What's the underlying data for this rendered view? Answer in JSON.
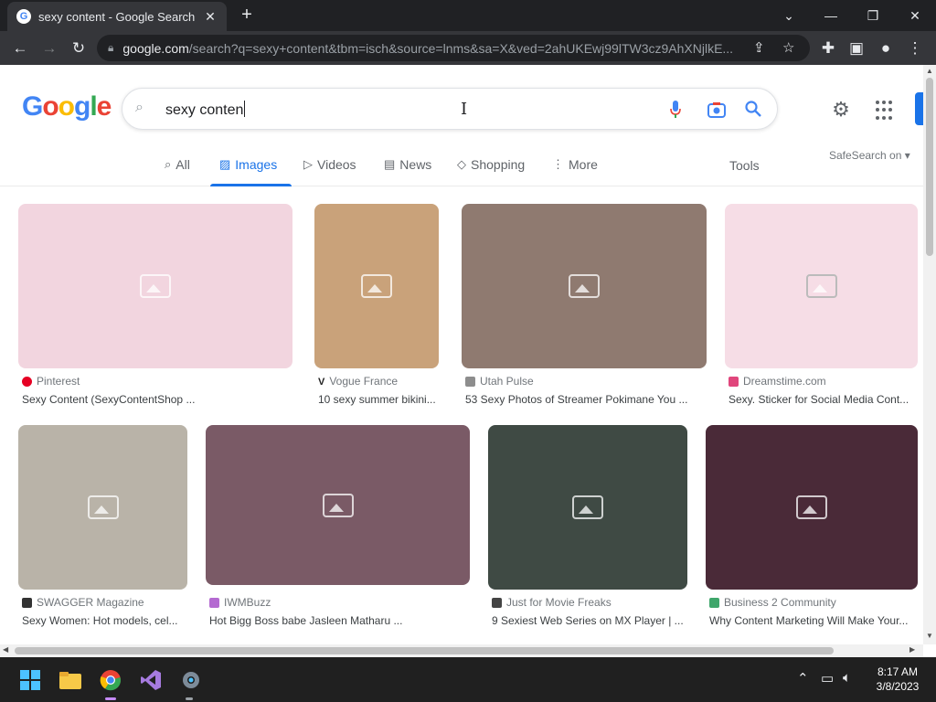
{
  "browser": {
    "tab_title": "sexy content - Google Search",
    "tab_close": "✕",
    "new_tab": "+",
    "url_host": "google.com",
    "url_rest": "/search?q=sexy+content&tbm=isch&source=lnms&sa=X&ved=2ahUKEwj99lTW3cz9AhXNjlkE...",
    "window_controls": {
      "minimize": "—",
      "restore": "❐",
      "close": "✕",
      "dropdown": "⌄"
    }
  },
  "google": {
    "logo_text": "Google",
    "query": "sexy conten",
    "tabs": [
      {
        "label": "All",
        "icon": "search-icon"
      },
      {
        "label": "Images",
        "icon": "image-icon"
      },
      {
        "label": "Videos",
        "icon": "play-icon"
      },
      {
        "label": "News",
        "icon": "news-icon"
      },
      {
        "label": "Shopping",
        "icon": "tag-icon"
      },
      {
        "label": "More",
        "icon": "more-vert-icon"
      }
    ],
    "tools_label": "Tools",
    "safesearch_label": "SafeSearch on ▾"
  },
  "results": [
    {
      "source": "Pinterest",
      "caption": "Sexy Content (SexyContentShop ...",
      "fav_color": "#e60023"
    },
    {
      "source": "Vogue France",
      "caption": "10 sexy summer bikini...",
      "fav_color": "#222222"
    },
    {
      "source": "Utah Pulse",
      "caption": "53 Sexy Photos of Streamer Pokimane You ...",
      "fav_color": "#8d8d8d"
    },
    {
      "source": "Dreamstime.com",
      "caption": "Sexy. Sticker for Social Media Cont...",
      "fav_color": "#e0467c"
    },
    {
      "source": "SWAGGER Magazine",
      "caption": "Sexy Women: Hot models, cel...",
      "fav_color": "#333333"
    },
    {
      "source": "IWMBuzz",
      "caption": "Hot Bigg Boss babe Jasleen Matharu ...",
      "fav_color": "#b46ad1"
    },
    {
      "source": "Just for Movie Freaks",
      "caption": "9 Sexiest Web Series on MX Player | ...",
      "fav_color": "#444444"
    },
    {
      "source": "Business 2 Community",
      "caption": "Why Content Marketing Will Make Your...",
      "fav_color": "#3fa66b"
    }
  ],
  "taskbar": {
    "time": "8:17 AM",
    "date": "3/8/2023"
  },
  "colors": {
    "accent": "#1a73e8",
    "chrome_dark": "#202124",
    "chrome_toolbar": "#35363a"
  }
}
